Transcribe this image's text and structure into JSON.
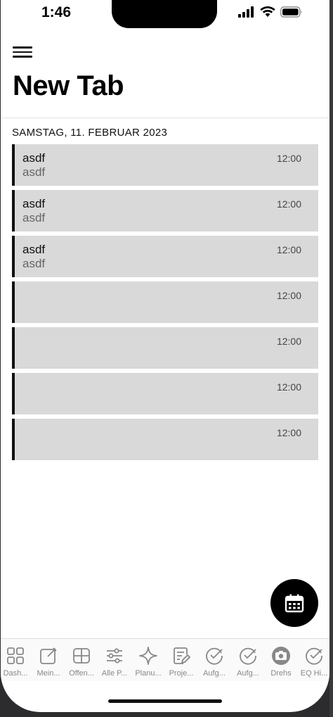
{
  "status_bar": {
    "time": "1:46"
  },
  "header": {
    "title": "New Tab"
  },
  "date_header": "SAMSTAG, 11. FEBRUAR 2023",
  "events": [
    {
      "title": "asdf",
      "subtitle": "asdf",
      "time": "12:00"
    },
    {
      "title": "asdf",
      "subtitle": "asdf",
      "time": "12:00"
    },
    {
      "title": "asdf",
      "subtitle": "asdf",
      "time": "12:00"
    },
    {
      "title": "",
      "subtitle": "",
      "time": "12:00"
    },
    {
      "title": "",
      "subtitle": "",
      "time": "12:00"
    },
    {
      "title": "",
      "subtitle": "",
      "time": "12:00"
    },
    {
      "title": "",
      "subtitle": "",
      "time": "12:00"
    }
  ],
  "tabbar": {
    "tabs": [
      {
        "label": "Dash...",
        "icon": "grid-icon"
      },
      {
        "label": "Mein...",
        "icon": "edit-note-icon"
      },
      {
        "label": "Offen...",
        "icon": "split-box-icon"
      },
      {
        "label": "Alle P...",
        "icon": "sliders-icon"
      },
      {
        "label": "Planu...",
        "icon": "sparkle-icon"
      },
      {
        "label": "Proje...",
        "icon": "document-edit-icon"
      },
      {
        "label": "Aufg...",
        "icon": "check-circle-icon"
      },
      {
        "label": "Aufg...",
        "icon": "check-circle-icon"
      },
      {
        "label": "Drehs",
        "icon": "camera-icon"
      },
      {
        "label": "EQ Hi...",
        "icon": "check-circle-icon"
      }
    ]
  },
  "colors": {
    "row_background": "#d9d9d9",
    "row_accent": "#111111",
    "fab_background": "#000000"
  }
}
